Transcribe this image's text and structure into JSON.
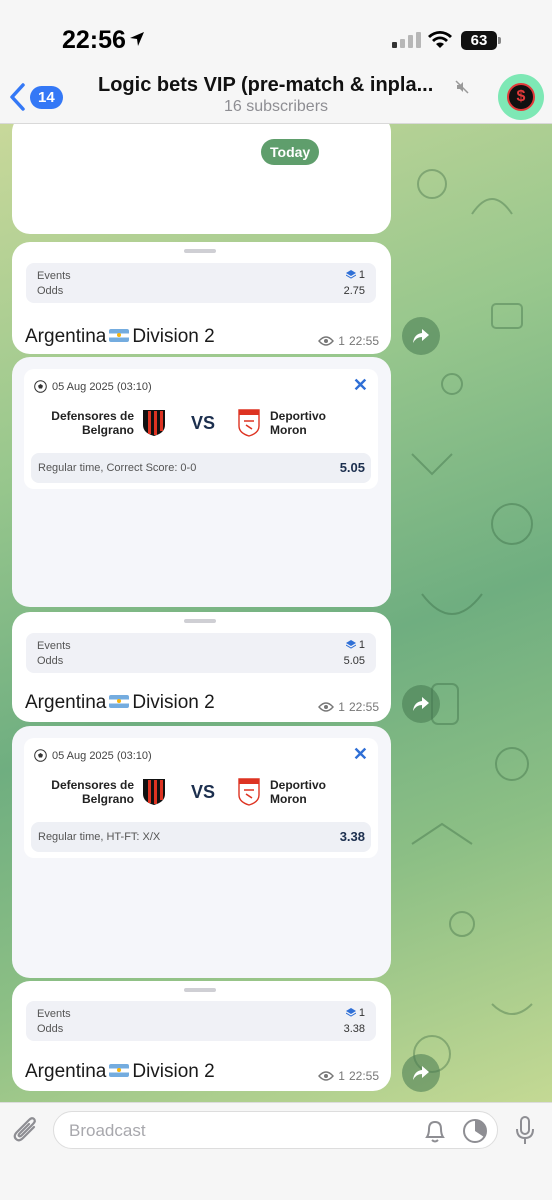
{
  "status_bar": {
    "time": "22:56",
    "battery": "63"
  },
  "header": {
    "back_count": "14",
    "title": "Logic bets VIP (pre-match & inpla...",
    "subtitle": "16 subscribers"
  },
  "chat": {
    "date_badge": "Today",
    "posts": [
      {
        "events_label": "Events",
        "events_value": "1",
        "odds_label": "Odds",
        "odds_value": "2.75",
        "league_a": "Argentina",
        "league_b": "Division 2",
        "views": "1",
        "time": "22:55"
      },
      {
        "events_label": "Events",
        "events_value": "1",
        "odds_label": "Odds",
        "odds_value": "5.05",
        "league_a": "Argentina",
        "league_b": "Division 2",
        "views": "1",
        "time": "22:55"
      },
      {
        "events_label": "Events",
        "events_value": "1",
        "odds_label": "Odds",
        "odds_value": "3.38",
        "league_a": "Argentina",
        "league_b": "Division 2",
        "views": "1",
        "time": "22:55"
      }
    ],
    "matches": [
      {
        "date": "05 Aug 2025 (03:10)",
        "home_line1": "Defensores de",
        "home_line2": "Belgrano",
        "vs": "VS",
        "away_line1": "Deportivo",
        "away_line2": "Moron",
        "bet": "Regular time, Correct Score: 0-0",
        "odd": "5.05"
      },
      {
        "date": "05 Aug 2025 (03:10)",
        "home_line1": "Defensores de",
        "home_line2": "Belgrano",
        "vs": "VS",
        "away_line1": "Deportivo",
        "away_line2": "Moron",
        "bet": "Regular time, HT-FT: X/X",
        "odd": "3.38"
      }
    ]
  },
  "input": {
    "placeholder": "Broadcast"
  },
  "colors": {
    "accent": "#3478f6",
    "date_badge": "#5f9e6c",
    "avatar_bg": "#7ee8b5"
  }
}
